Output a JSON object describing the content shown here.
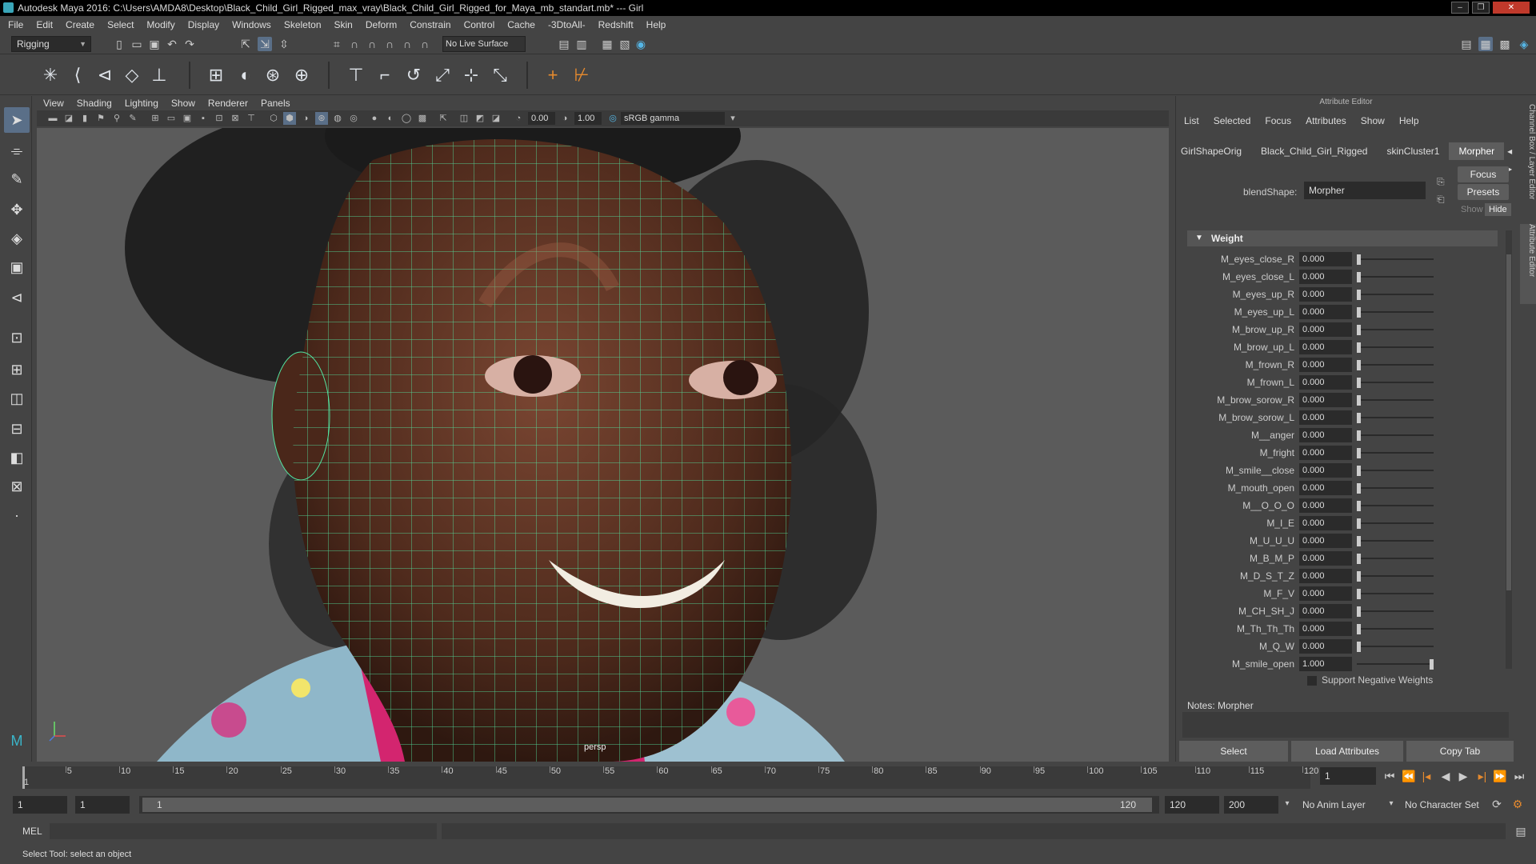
{
  "titlebar": {
    "title": "Autodesk Maya 2016: C:\\Users\\AMDA8\\Desktop\\Black_Child_Girl_Rigged_max_vray\\Black_Child_Girl_Rigged_for_Maya_mb_standart.mb*   ---   Girl"
  },
  "menu": [
    "File",
    "Edit",
    "Create",
    "Select",
    "Modify",
    "Display",
    "Windows",
    "Skeleton",
    "Skin",
    "Deform",
    "Constrain",
    "Control",
    "Cache",
    "-3DtoAll-",
    "Redshift",
    "Help"
  ],
  "toolbar": {
    "mode": "Rigging",
    "live_surface": "No Live Surface"
  },
  "viewport": {
    "menu": [
      "View",
      "Shading",
      "Lighting",
      "Show",
      "Renderer",
      "Panels"
    ],
    "exposure": "0.00",
    "gamma": "1.00",
    "color_space": "sRGB gamma",
    "camera_label": "persp"
  },
  "attribute_editor": {
    "title": "Attribute Editor",
    "menu": [
      "List",
      "Selected",
      "Focus",
      "Attributes",
      "Show",
      "Help"
    ],
    "tabs": [
      "GirlShapeOrig",
      "Black_Child_Girl_Rigged",
      "skinCluster1",
      "Morpher"
    ],
    "active_tab": "Morpher",
    "focus_label": "Focus",
    "presets_label": "Presets",
    "show_label": "Show",
    "hide_label": "Hide",
    "blendshape_label": "blendShape:",
    "blendshape_value": "Morpher",
    "section": "Weight",
    "weights": [
      {
        "name": "M_eyes_close_R",
        "value": "0.000",
        "level": 0
      },
      {
        "name": "M_eyes_close_L",
        "value": "0.000",
        "level": 0
      },
      {
        "name": "M_eyes_up_R",
        "value": "0.000",
        "level": 0
      },
      {
        "name": "M_eyes_up_L",
        "value": "0.000",
        "level": 0
      },
      {
        "name": "M_brow_up_R",
        "value": "0.000",
        "level": 0
      },
      {
        "name": "M_brow_up_L",
        "value": "0.000",
        "level": 0
      },
      {
        "name": "M_frown_R",
        "value": "0.000",
        "level": 0
      },
      {
        "name": "M_frown_L",
        "value": "0.000",
        "level": 0
      },
      {
        "name": "M_brow_sorow_R",
        "value": "0.000",
        "level": 0
      },
      {
        "name": "M_brow_sorow_L",
        "value": "0.000",
        "level": 0
      },
      {
        "name": "M__anger",
        "value": "0.000",
        "level": 0
      },
      {
        "name": "M_fright",
        "value": "0.000",
        "level": 0
      },
      {
        "name": "M_smile__close",
        "value": "0.000",
        "level": 0
      },
      {
        "name": "M_mouth_open",
        "value": "0.000",
        "level": 0
      },
      {
        "name": "M__O_O_O",
        "value": "0.000",
        "level": 0
      },
      {
        "name": "M_I_E",
        "value": "0.000",
        "level": 0
      },
      {
        "name": "M_U_U_U",
        "value": "0.000",
        "level": 0
      },
      {
        "name": "M_B_M_P",
        "value": "0.000",
        "level": 0
      },
      {
        "name": "M_D_S_T_Z",
        "value": "0.000",
        "level": 0
      },
      {
        "name": "M_F_V",
        "value": "0.000",
        "level": 0
      },
      {
        "name": "M_CH_SH_J",
        "value": "0.000",
        "level": 0
      },
      {
        "name": "M_Th_Th_Th",
        "value": "0.000",
        "level": 0
      },
      {
        "name": "M_Q_W",
        "value": "0.000",
        "level": 0
      },
      {
        "name": "M_smile_open",
        "value": "1.000",
        "level": 1
      }
    ],
    "support_negative": "Support Negative Weights",
    "notes_label": "Notes:  Morpher",
    "buttons": {
      "select": "Select",
      "load": "Load Attributes",
      "copy": "Copy Tab"
    },
    "side_tabs": [
      "Channel Box / Layer Editor",
      "Attribute Editor"
    ]
  },
  "timeline": {
    "ticks": [
      "1",
      "5",
      "10",
      "15",
      "20",
      "25",
      "30",
      "35",
      "40",
      "45",
      "50",
      "55",
      "60",
      "65",
      "70",
      "75",
      "80",
      "85",
      "90",
      "95",
      "100",
      "105",
      "110",
      "115",
      "120"
    ],
    "current_frame": "1"
  },
  "range": {
    "start": "1",
    "playback_start": "1",
    "slider_start": "1",
    "slider_end": "120",
    "playback_end": "120",
    "end": "200",
    "anim_layer": "No Anim Layer",
    "character_set": "No Character Set"
  },
  "mel": {
    "label": "MEL"
  },
  "status": {
    "text": "Select Tool: select an object"
  }
}
